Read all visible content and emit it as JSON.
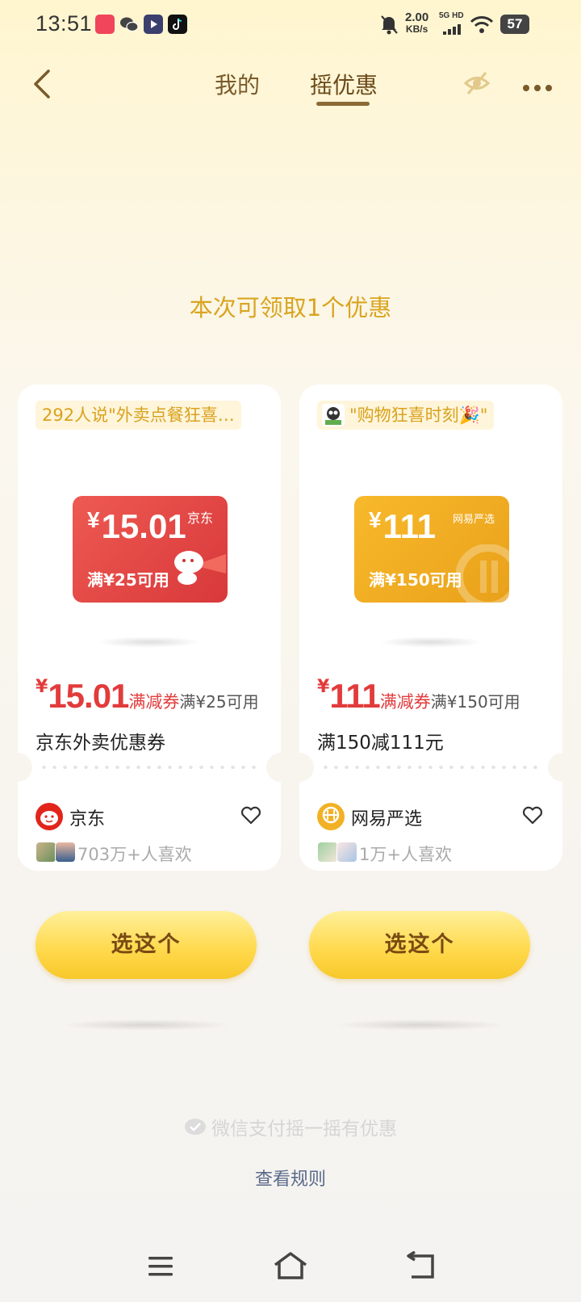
{
  "status_bar": {
    "time": "13:51",
    "network_speed_value": "2.00",
    "network_speed_unit": "KB/s",
    "signal_label": "5G HD",
    "battery": "57"
  },
  "header": {
    "tabs": [
      {
        "label": "我的",
        "active": false
      },
      {
        "label": "摇优惠",
        "active": true
      }
    ]
  },
  "headline": "本次可领取1个优惠",
  "offers": [
    {
      "tagline": "292人说\"外卖点餐狂喜…",
      "coupon": {
        "currency": "¥",
        "amount": "15.01",
        "brand": "京东",
        "condition": "满¥25可用",
        "color": "#e04a46"
      },
      "price": {
        "currency": "¥",
        "amount": "15.01",
        "type": "满减券",
        "condition": "满¥25可用"
      },
      "title": "京东外卖优惠券",
      "brand_name": "京东",
      "likes": "703万+人喜欢",
      "button": "选这个"
    },
    {
      "tagline": "\"购物狂喜时刻🎉\"",
      "coupon": {
        "currency": "¥",
        "amount": "111",
        "brand": "网易严选",
        "condition": "满¥150可用",
        "color": "#f2ae22"
      },
      "price": {
        "currency": "¥",
        "amount": "111",
        "type": "满减券",
        "condition": "满¥150可用"
      },
      "title": "满150减111元",
      "brand_name": "网易严选",
      "likes": "1万+人喜欢",
      "button": "选这个"
    }
  ],
  "footer": {
    "brand_text": "微信支付摇一摇有优惠",
    "rules_link": "查看规则"
  },
  "colors": {
    "accent_gold": "#d9a520",
    "price_red": "#e23b3b",
    "button_yellow": "#ffd84a"
  },
  "icons": [
    "back-arrow-icon",
    "eye-hidden-icon",
    "more-icon",
    "heart-icon",
    "wechat-pay-icon",
    "menu-icon",
    "home-icon",
    "return-icon"
  ]
}
